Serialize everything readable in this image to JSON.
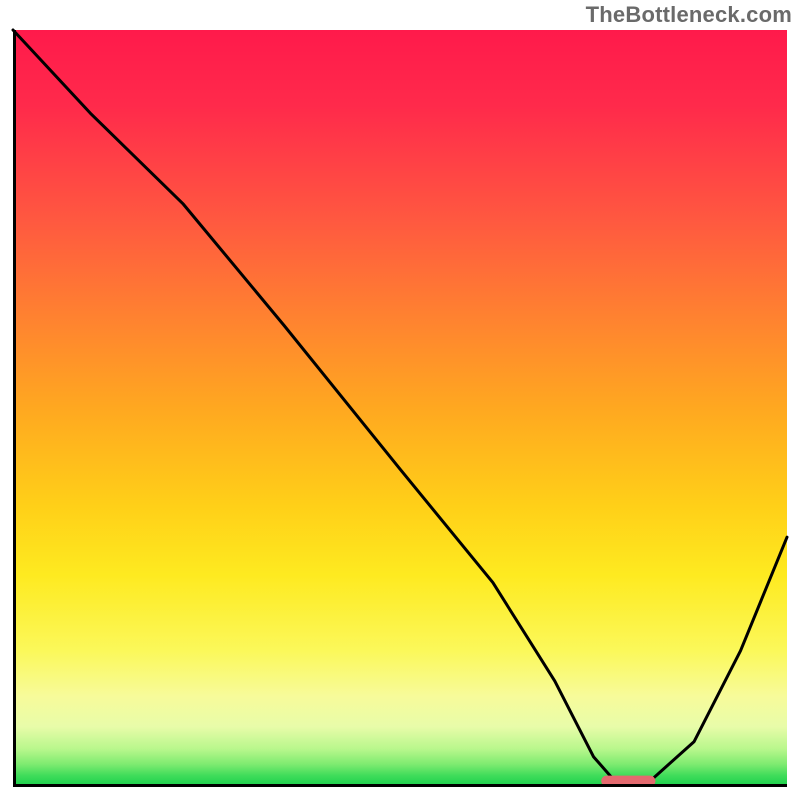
{
  "watermark": "TheBottleneck.com",
  "chart_data": {
    "type": "line",
    "title": "",
    "xlabel": "",
    "ylabel": "",
    "xlim": [
      0,
      100
    ],
    "ylim": [
      0,
      100
    ],
    "grid": false,
    "background": "gradient-red-to-green-vertical",
    "series": [
      {
        "name": "bottleneck-curve",
        "x": [
          0,
          10,
          22,
          35,
          50,
          62,
          70,
          75,
          78,
          82,
          88,
          94,
          100
        ],
        "y": [
          100,
          89,
          77,
          61,
          42,
          27,
          14,
          4,
          0.5,
          0.5,
          6,
          18,
          33
        ]
      }
    ],
    "marker": {
      "name": "optimal-range",
      "shape": "rounded-bar",
      "x_start": 76,
      "x_end": 83,
      "y": 0.5,
      "color": "#e46a6f"
    },
    "background_stops": [
      {
        "pos": 0,
        "color": "#ff1a4b"
      },
      {
        "pos": 0.1,
        "color": "#ff2a4b"
      },
      {
        "pos": 0.25,
        "color": "#ff5840"
      },
      {
        "pos": 0.38,
        "color": "#ff8230"
      },
      {
        "pos": 0.5,
        "color": "#ffa820"
      },
      {
        "pos": 0.63,
        "color": "#ffd018"
      },
      {
        "pos": 0.72,
        "color": "#feea20"
      },
      {
        "pos": 0.82,
        "color": "#fbf85a"
      },
      {
        "pos": 0.88,
        "color": "#f7fb9a"
      },
      {
        "pos": 0.92,
        "color": "#e8fca9"
      },
      {
        "pos": 0.95,
        "color": "#b8f78c"
      },
      {
        "pos": 0.97,
        "color": "#7eeb70"
      },
      {
        "pos": 0.985,
        "color": "#3fdc5a"
      },
      {
        "pos": 1.0,
        "color": "#18cf4b"
      }
    ]
  }
}
